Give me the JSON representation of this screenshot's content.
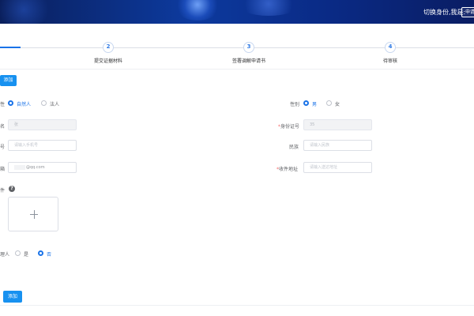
{
  "header": {
    "switch_label": "切换身份,我是:",
    "user_button": "申请"
  },
  "steps": [
    {
      "number": "2",
      "label": "提交证据材料"
    },
    {
      "number": "3",
      "label": "签署调解申请书"
    },
    {
      "number": "4",
      "label": "待审核"
    }
  ],
  "top_add_button": "添加",
  "form": {
    "party_type": {
      "label": "性",
      "options": [
        "自然人",
        "法人"
      ],
      "selected": "自然人"
    },
    "gender": {
      "label": "性别",
      "options": [
        "男",
        "女"
      ],
      "selected": "男"
    },
    "name": {
      "label": "名",
      "value": "张"
    },
    "id_number": {
      "label": "身份证号",
      "value": "35"
    },
    "phone": {
      "label": "号",
      "placeholder": "请输入手机号"
    },
    "ethnicity": {
      "label": "民族",
      "placeholder": "请输入民族"
    },
    "email": {
      "label": "箱",
      "value": "@qq.com"
    },
    "address": {
      "label": "收件地址",
      "placeholder": "请输入送达地址"
    },
    "attachment": {
      "label": "件"
    },
    "agent": {
      "label": "理人",
      "options": [
        "是",
        "否"
      ],
      "selected": "否"
    }
  },
  "bottom_add_button": "添加",
  "colors": {
    "primary": "#1a73e8",
    "header": "#0d2f87",
    "button": "#1791f0"
  },
  "icons": [
    "help-icon",
    "plus-icon"
  ]
}
